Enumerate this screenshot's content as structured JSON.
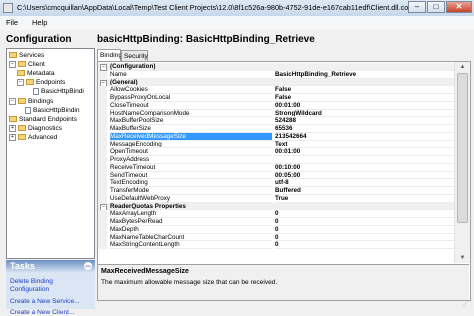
{
  "window": {
    "title": "C:\\Users\\cmcquillan\\AppData\\Local\\Temp\\Test Client Projects\\12.0\\8f1c526a-980b-4752-91de-e167cab11edf\\Client.dll.config...",
    "min": "–",
    "max": "□",
    "close": "✕"
  },
  "menu": {
    "file": "File",
    "help": "Help"
  },
  "config": {
    "header": "Configuration",
    "tree": {
      "services": "Services",
      "client": "Client",
      "metadata": "Metadata",
      "endpoints": "Endpoints",
      "endpoint_item": "BasicHttpBindi",
      "bindings": "Bindings",
      "binding_item": "BasicHttpBindin",
      "standard_endpoints": "Standard Endpoints",
      "diagnostics": "Diagnostics",
      "advanced": "Advanced"
    }
  },
  "tasks": {
    "title": "Tasks",
    "chevron": "︽",
    "delete_binding_line1": "Delete Binding",
    "delete_binding_line2": "Configuration",
    "create_service": "Create a New Service...",
    "create_client": "Create a New Client..."
  },
  "main": {
    "title": "basicHttpBinding: BasicHttpBinding_Retrieve",
    "tabs": {
      "binding": "Binding",
      "security": "Security"
    }
  },
  "properties": {
    "cat_configuration": "(Configuration)",
    "rows_config": [
      {
        "name": "Name",
        "value": "BasicHttpBinding_Retrieve"
      }
    ],
    "cat_general": "(General)",
    "rows_general": [
      {
        "name": "AllowCookies",
        "value": "False"
      },
      {
        "name": "BypassProxyOnLocal",
        "value": "False"
      },
      {
        "name": "CloseTimeout",
        "value": "00:01:00"
      },
      {
        "name": "HostNameComparisonMode",
        "value": "StrongWildcard"
      },
      {
        "name": "MaxBufferPoolSize",
        "value": "524288"
      },
      {
        "name": "MaxBufferSize",
        "value": "65536"
      },
      {
        "name": "MaxReceivedMessageSize",
        "value": "213542664"
      },
      {
        "name": "MessageEncoding",
        "value": "Text"
      },
      {
        "name": "OpenTimeout",
        "value": "00:01:00"
      },
      {
        "name": "ProxyAddress",
        "value": ""
      },
      {
        "name": "ReceiveTimeout",
        "value": "00:10:00"
      },
      {
        "name": "SendTimeout",
        "value": "00:05:00"
      },
      {
        "name": "TextEncoding",
        "value": "utf-8"
      },
      {
        "name": "TransferMode",
        "value": "Buffered"
      },
      {
        "name": "UseDefaultWebProxy",
        "value": "True"
      }
    ],
    "cat_reader": "ReaderQuotas Properties",
    "rows_reader": [
      {
        "name": "MaxArrayLength",
        "value": "0"
      },
      {
        "name": "MaxBytesPerRead",
        "value": "0"
      },
      {
        "name": "MaxDepth",
        "value": "0"
      },
      {
        "name": "MaxNameTableCharCount",
        "value": "0"
      },
      {
        "name": "MaxStringContentLength",
        "value": "0"
      }
    ],
    "selected": "MaxReceivedMessageSize",
    "selected_color": "#3399ff"
  },
  "description": {
    "title": "MaxReceivedMessageSize",
    "text": "The maximum allowable message size that can be received."
  }
}
